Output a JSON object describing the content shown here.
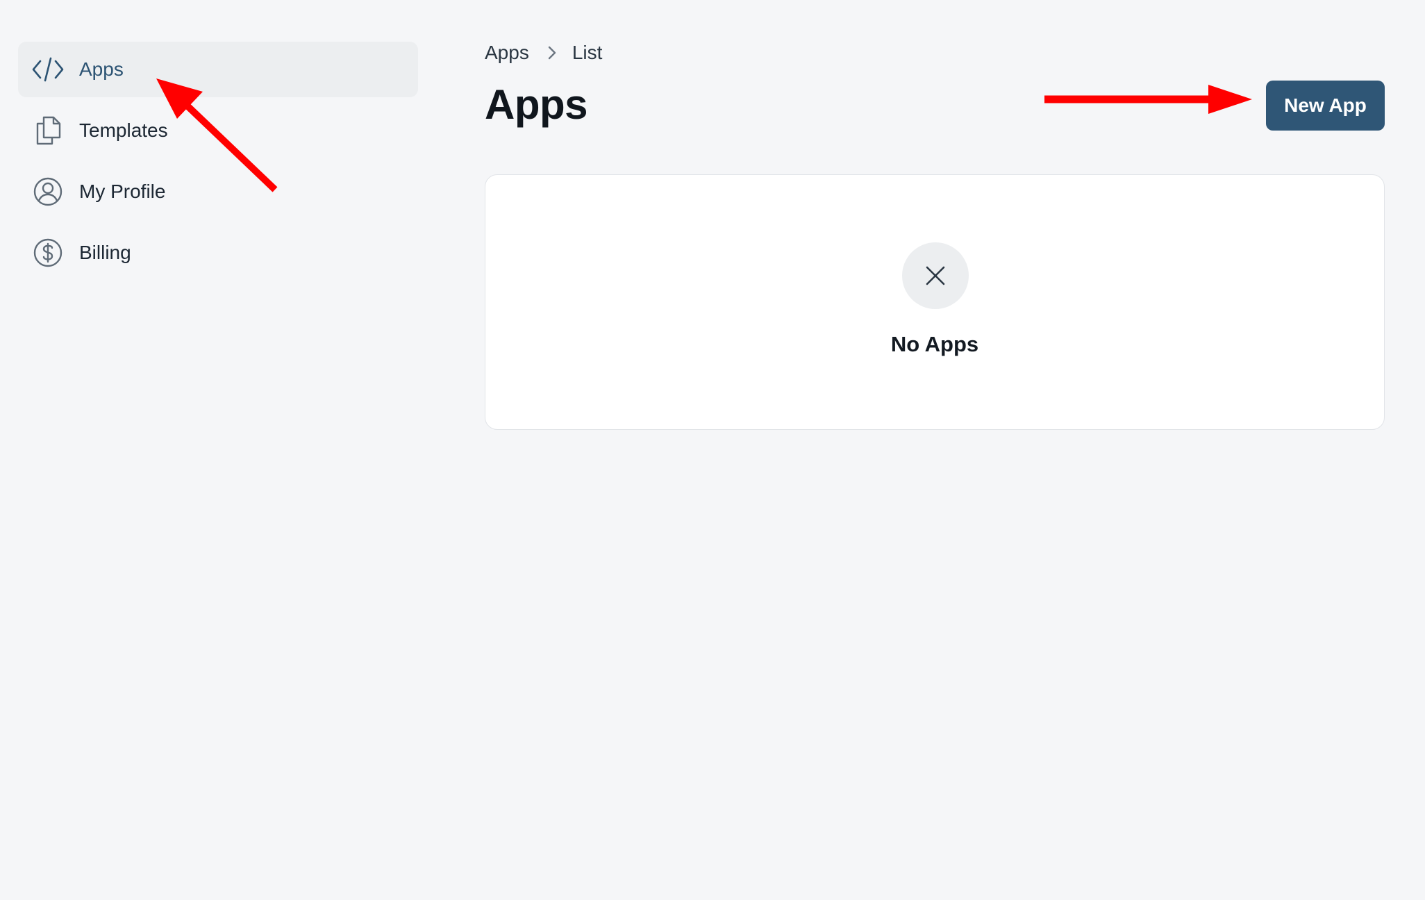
{
  "sidebar": {
    "items": [
      {
        "label": "Apps",
        "icon": "code-icon",
        "active": true
      },
      {
        "label": "Templates",
        "icon": "documents-icon",
        "active": false
      },
      {
        "label": "My Profile",
        "icon": "user-circle-icon",
        "active": false
      },
      {
        "label": "Billing",
        "icon": "dollar-circle-icon",
        "active": false
      }
    ]
  },
  "breadcrumb": {
    "items": [
      "Apps",
      "List"
    ],
    "separator_icon": "chevron-right-icon"
  },
  "header": {
    "title": "Apps",
    "new_app_label": "New App"
  },
  "empty_state": {
    "icon": "close-icon",
    "message": "No Apps"
  },
  "colors": {
    "background": "#f5f6f8",
    "primary": "#2f5676",
    "active_nav_bg": "#eceef0",
    "annotation_arrow": "#ff0000"
  }
}
